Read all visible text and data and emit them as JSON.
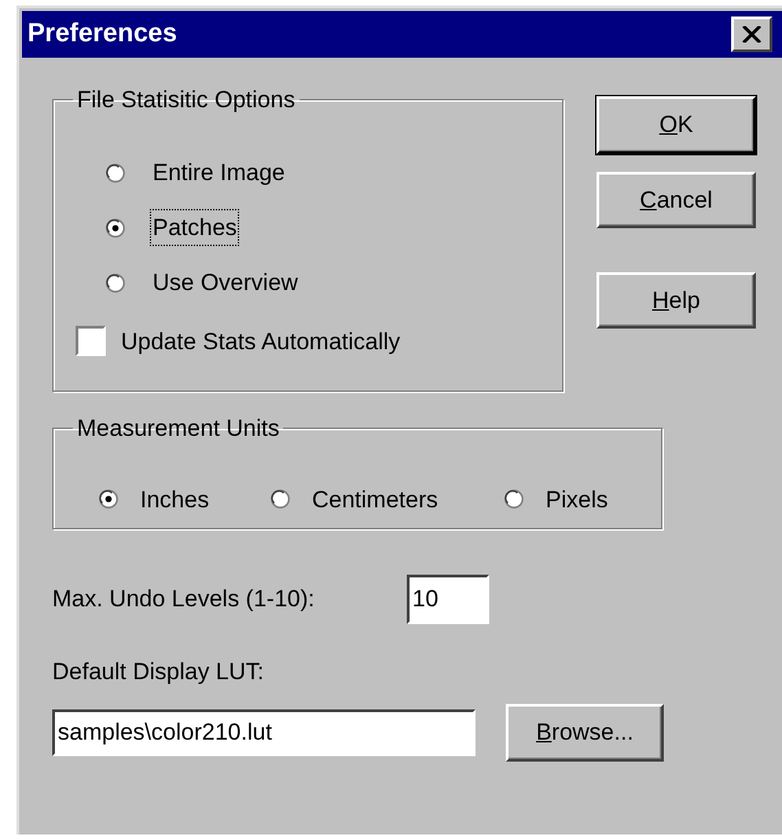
{
  "window": {
    "title": "Preferences"
  },
  "file_statistic_options": {
    "title": "File Statisitic Options",
    "options": [
      {
        "label": "Entire Image",
        "selected": false,
        "focused": false
      },
      {
        "label": "Patches",
        "selected": true,
        "focused": true
      },
      {
        "label": "Use Overview",
        "selected": false,
        "focused": false
      }
    ],
    "update_stats_automatically": {
      "label": "Update Stats Automatically",
      "checked": false
    }
  },
  "buttons": [
    {
      "label": "OK",
      "default": true
    },
    {
      "label": "Cancel",
      "default": false
    },
    {
      "label": "Help",
      "default": false
    }
  ],
  "measurement_units": {
    "title": "Measurement Units",
    "options": [
      {
        "label": "Inches",
        "selected": true
      },
      {
        "label": "Centimeters",
        "selected": false
      },
      {
        "label": "Pixels",
        "selected": false
      }
    ]
  },
  "max_undo_levels": {
    "label": "Max. Undo Levels (1-10):",
    "value": "10"
  },
  "default_display_lut": {
    "label": "Default Display LUT:",
    "value": "samples\\color210.lut",
    "browse_button": "Browse..."
  }
}
